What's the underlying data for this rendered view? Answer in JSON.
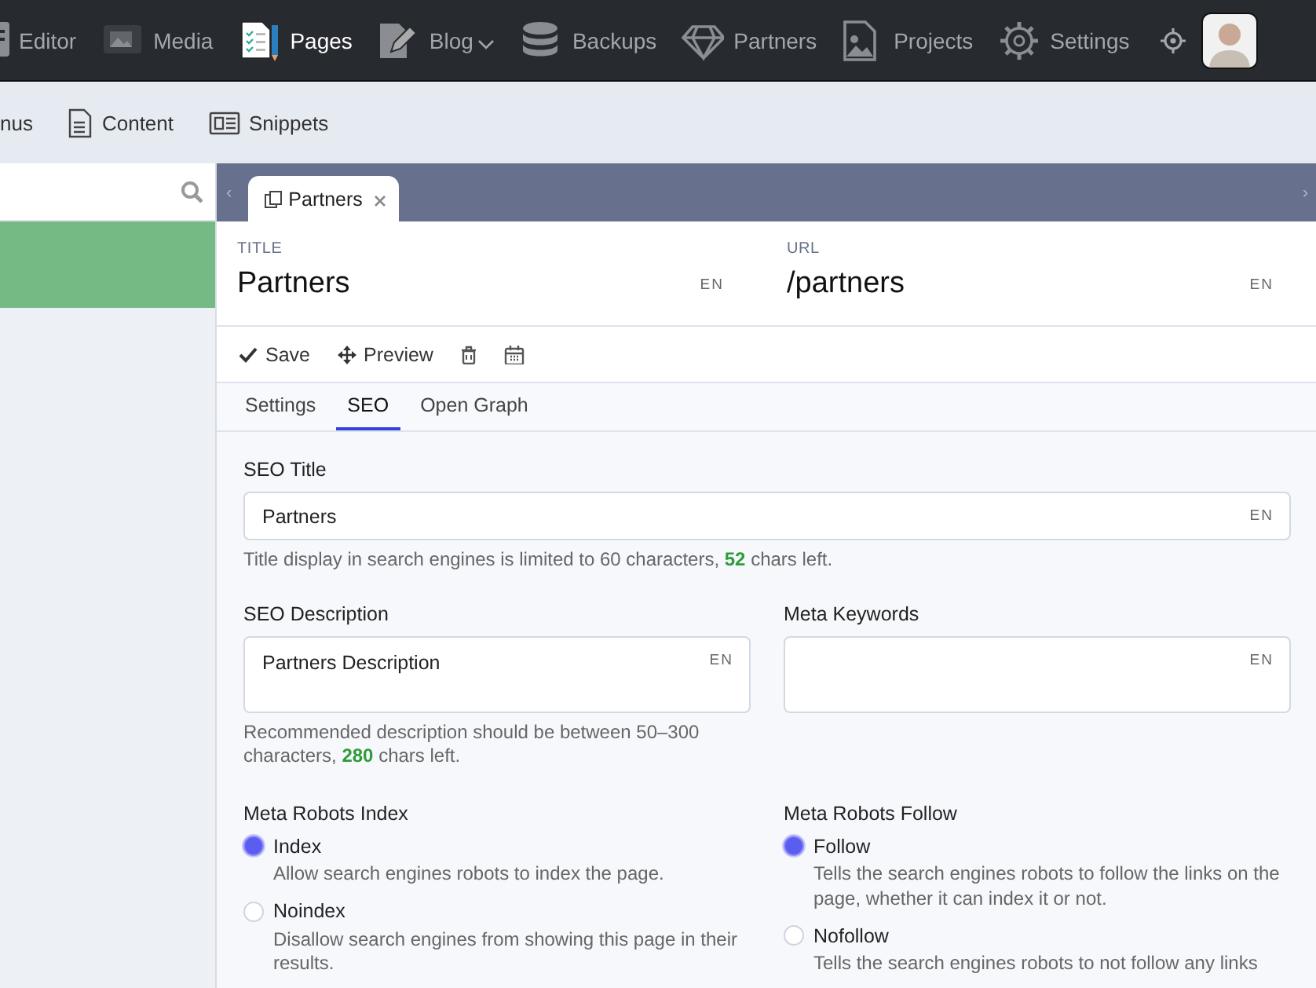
{
  "top_nav": {
    "items": [
      {
        "label": "Editor",
        "selected": false
      },
      {
        "label": "Media",
        "selected": false
      },
      {
        "label": "Pages",
        "selected": true
      },
      {
        "label": "Blog",
        "selected": false,
        "has_menu": true
      },
      {
        "label": "Backups",
        "selected": false
      },
      {
        "label": "Partners",
        "selected": false
      },
      {
        "label": "Projects",
        "selected": false
      },
      {
        "label": "Settings",
        "selected": false
      }
    ]
  },
  "sub_nav": {
    "items": [
      {
        "label": "nus"
      },
      {
        "label": "Content"
      },
      {
        "label": "Snippets"
      }
    ]
  },
  "editor_tabs": [
    {
      "label": "Partners",
      "selected": true
    }
  ],
  "tab_scroll": {
    "left": "‹",
    "right": "›"
  },
  "header": {
    "fields": [
      {
        "label": "TITLE",
        "value": "Partners",
        "lang": "EN"
      },
      {
        "label": "URL",
        "value": "/partners",
        "lang": "EN"
      }
    ]
  },
  "toolbar": {
    "buttons": [
      {
        "kind": "save",
        "label": "Save"
      },
      {
        "kind": "preview",
        "label": "Preview"
      },
      {
        "kind": "delete"
      },
      {
        "kind": "schedule"
      }
    ]
  },
  "section_tabs": [
    {
      "label": "Settings",
      "selected": false
    },
    {
      "label": "SEO",
      "selected": true
    },
    {
      "label": "Open Graph",
      "selected": false
    }
  ],
  "seo": {
    "seo_title": {
      "label": "SEO Title",
      "value": "Partners",
      "lang": "EN",
      "help": "Title display in search engines is limited to 60 characters, **52** chars left."
    },
    "seo_description": {
      "label": "SEO Description",
      "value": "Partners Description",
      "lang": "EN",
      "help": "Recommended description should be between 50–300 characters, **280** chars left."
    },
    "meta_keywords": {
      "label": "Meta Keywords",
      "lang": "EN"
    },
    "robots_index": {
      "label": "Meta Robots Index",
      "options": [
        {
          "label": "Index",
          "description": "Allow search engines robots to index the page.",
          "selected": true
        },
        {
          "label": "Noindex",
          "description": "Disallow search engines from showing this page in their results.",
          "selected": false
        }
      ]
    },
    "robots_follow": {
      "label": "Meta Robots Follow",
      "options": [
        {
          "label": "Follow",
          "description": "Tells the search engines robots to follow the links on the page, whether it can index it or not.",
          "selected": true
        },
        {
          "label": "Nofollow",
          "description": "Tells the search engines robots to not follow any links",
          "selected": false
        }
      ]
    }
  }
}
